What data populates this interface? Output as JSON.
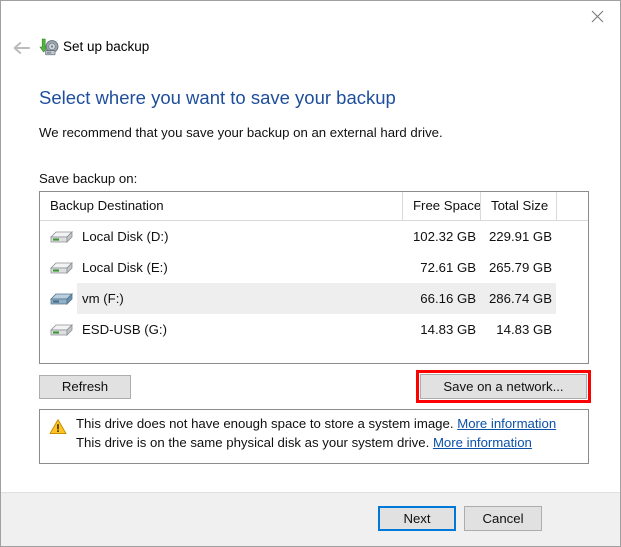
{
  "window": {
    "app_title": "Set up backup",
    "app_icon": "backup-disk-icon",
    "back_icon": "back-arrow-icon",
    "close_icon": "close-icon"
  },
  "page": {
    "heading": "Select where you want to save your backup",
    "subheading": "We recommend that you save your backup on an external hard drive.",
    "save_label": "Save backup on:"
  },
  "table": {
    "columns": {
      "destination": "Backup Destination",
      "free_space": "Free Space",
      "total_size": "Total Size"
    },
    "rows": [
      {
        "name": "Local Disk (D:)",
        "free_space": "102.32 GB",
        "total_size": "229.91 GB",
        "icon": "hard-drive-icon",
        "selected": false
      },
      {
        "name": "Local Disk (E:)",
        "free_space": "72.61 GB",
        "total_size": "265.79 GB",
        "icon": "hard-drive-icon",
        "selected": false
      },
      {
        "name": "vm (F:)",
        "free_space": "66.16 GB",
        "total_size": "286.74 GB",
        "icon": "hard-drive-icon",
        "selected": true
      },
      {
        "name": "ESD-USB (G:)",
        "free_space": "14.83 GB",
        "total_size": "14.83 GB",
        "icon": "hard-drive-icon",
        "selected": false
      }
    ]
  },
  "actions": {
    "refresh": "Refresh",
    "save_on_network": "Save on a network...",
    "highlight_color": "#ff0000"
  },
  "warning": {
    "icon": "warning-triangle-icon",
    "line1_text": "This drive does not have enough space to store a system image.",
    "line1_link": "More information",
    "line2_text": "This drive is on the same physical disk as your system drive.",
    "line2_link": "More information"
  },
  "footer": {
    "next": "Next",
    "cancel": "Cancel",
    "focus_color": "#0078d7"
  }
}
